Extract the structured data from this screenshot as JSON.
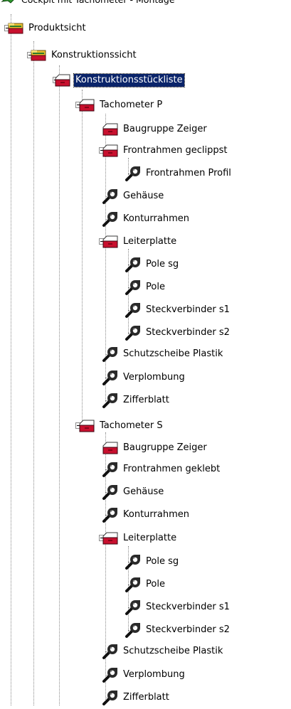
{
  "tree": {
    "selected": "Konstruktionsstückliste",
    "nodes": [
      {
        "label": "Cockpit mit Tachometer - Montage",
        "icon": "assembly-root-icon"
      },
      {
        "label": "Produktsicht",
        "icon": "view-folder-icon",
        "expanded": true
      },
      {
        "label": "Konstruktionssicht",
        "icon": "view-folder-icon",
        "expanded": true
      },
      {
        "label": "Konstruktionsstückliste",
        "icon": "bom-icon",
        "expanded": true
      },
      {
        "label": "Tachometer P",
        "icon": "bom-icon",
        "expanded": true
      },
      {
        "label": "Baugruppe Zeiger",
        "icon": "bom-icon"
      },
      {
        "label": "Frontrahmen geclippst",
        "icon": "bom-icon",
        "expanded": true
      },
      {
        "label": "Frontrahmen Profil",
        "icon": "part-wrench-icon"
      },
      {
        "label": "Gehäuse",
        "icon": "part-wrench-icon"
      },
      {
        "label": "Konturrahmen",
        "icon": "part-wrench-icon"
      },
      {
        "label": "Leiterplatte",
        "icon": "bom-icon",
        "expanded": true
      },
      {
        "label": "Pole sg",
        "icon": "part-wrench-icon"
      },
      {
        "label": "Pole",
        "icon": "part-wrench-icon"
      },
      {
        "label": "Steckverbinder  s1",
        "icon": "part-wrench-icon"
      },
      {
        "label": "Steckverbinder  s2",
        "icon": "part-wrench-icon"
      },
      {
        "label": "Schutzscheibe Plastik",
        "icon": "part-wrench-icon"
      },
      {
        "label": "Verplombung",
        "icon": "part-wrench-icon"
      },
      {
        "label": "Zifferblatt",
        "icon": "part-wrench-icon"
      },
      {
        "label": "Tachometer S",
        "icon": "bom-icon",
        "expanded": true
      },
      {
        "label": "Baugruppe Zeiger",
        "icon": "bom-icon"
      },
      {
        "label": "Frontrahmen geklebt",
        "icon": "part-wrench-icon"
      },
      {
        "label": "Gehäuse",
        "icon": "part-wrench-icon"
      },
      {
        "label": "Konturrahmen",
        "icon": "part-wrench-icon"
      },
      {
        "label": "Leiterplatte",
        "icon": "bom-icon",
        "expanded": true
      },
      {
        "label": "Pole sg",
        "icon": "part-wrench-icon"
      },
      {
        "label": "Pole",
        "icon": "part-wrench-icon"
      },
      {
        "label": "Steckverbinder  s1",
        "icon": "part-wrench-icon"
      },
      {
        "label": "Steckverbinder  s2",
        "icon": "part-wrench-icon"
      },
      {
        "label": "Schutzscheibe Plastik",
        "icon": "part-wrench-icon"
      },
      {
        "label": "Verplombung",
        "icon": "part-wrench-icon"
      },
      {
        "label": "Zifferblatt",
        "icon": "part-wrench-icon"
      }
    ]
  },
  "colors": {
    "selection_bg": "#0a246a",
    "selection_text": "#ffffff",
    "bom_red": "#c8102e",
    "folder_yellow": "#e8c030",
    "root_green": "#2e9a2e"
  }
}
